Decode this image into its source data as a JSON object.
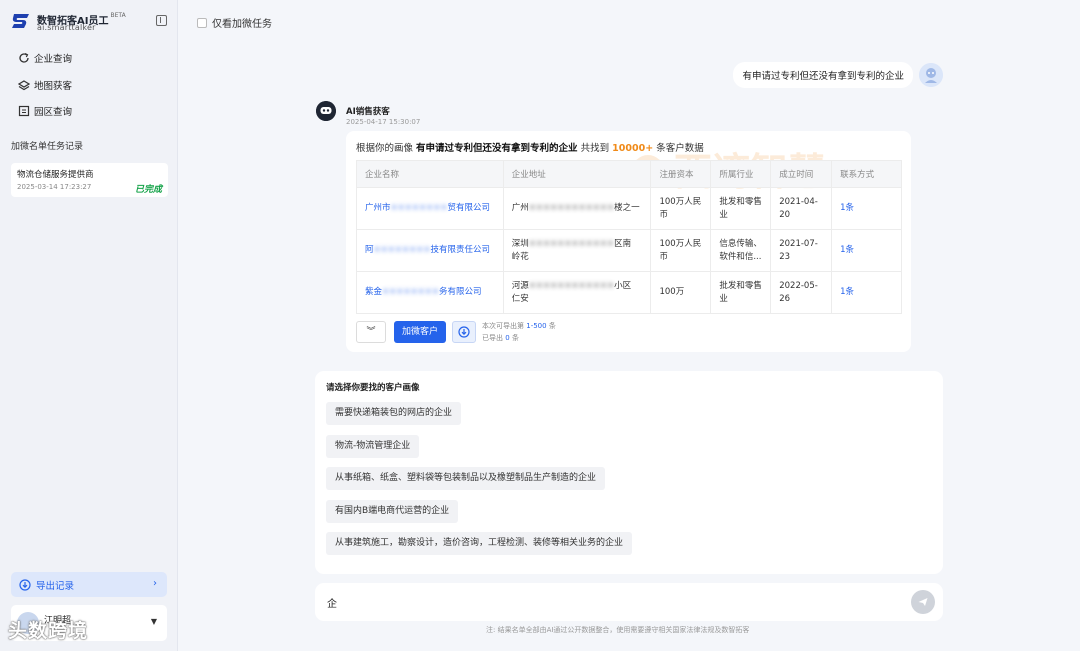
{
  "app": {
    "title": "数智拓客AI员工",
    "beta": "BETA",
    "domain": "ai.smarttalker"
  },
  "sidebar": {
    "nav": [
      {
        "label": "企业查询",
        "icon": "refresh-search-icon"
      },
      {
        "label": "地图获客",
        "icon": "map-layers-icon"
      },
      {
        "label": "园区查询",
        "icon": "park-building-icon"
      }
    ],
    "section_title": "加微名单任务记录",
    "task": {
      "name": "物流仓储服务提供商",
      "time": "2025-03-14 17:23:27",
      "status": "已完成"
    },
    "export_label": "导出记录",
    "user_name": "江明超"
  },
  "filter": {
    "label": "仅看加微任务"
  },
  "chat": {
    "user_message": "有申请过专利但还没有拿到专利的企业",
    "bot_name": "AI销售获客",
    "bot_time": "2025-04-17 15:30:07",
    "summary": {
      "prefix": "根据你的画像",
      "query": "有申请过专利但还没有拿到专利的企业",
      "mid": "共找到",
      "count": "10000+",
      "suffix": "条客户数据"
    },
    "watermark": "西湾智慧",
    "table": {
      "headers": [
        "企业名称",
        "企业地址",
        "注册资本",
        "所属行业",
        "成立时间",
        "联系方式"
      ],
      "rows": [
        {
          "name_a": "广州市",
          "name_mask": "××××××××",
          "name_b": "贸有限公司",
          "addr_a": "广州",
          "addr_mask": "××××××××××××",
          "addr_b": "楼之一",
          "addr_c": "",
          "capital": "100万人民币",
          "industry": "批发和零售业",
          "founded": "2021-04-20",
          "contact": "1条"
        },
        {
          "name_a": "阿",
          "name_mask": "××××××××",
          "name_b": "技有限责任公司",
          "addr_a": "深圳",
          "addr_mask": "××××××××××××",
          "addr_b": "区南",
          "addr_c": "岭花",
          "capital": "100万人民币",
          "industry": "信息传输、软件和信...",
          "founded": "2021-07-23",
          "contact": "1条"
        },
        {
          "name_a": "紫金",
          "name_mask": "××××××××",
          "name_b": "务有限公司",
          "addr_a": "河源",
          "addr_mask": "××××××××××××",
          "addr_b": "小区",
          "addr_c": "仁安",
          "capital": "100万",
          "industry": "批发和零售业",
          "founded": "2022-05-26",
          "contact": "1条"
        }
      ]
    },
    "actions": {
      "add_label": "加微客户",
      "export_range_prefix": "本次可导出第",
      "export_range": "1-500",
      "export_range_suffix": "条",
      "exported_prefix": "已导出",
      "exported": "0",
      "exported_suffix": "条"
    }
  },
  "picker": {
    "title": "请选择你要找的客户画像",
    "options": [
      "需要快递箱装包的网店的企业",
      "物流-物流管理企业",
      "从事纸箱、纸盒、塑料袋等包装制品以及橡塑制品生产制造的企业",
      "有国内B端电商代运营的企业",
      "从事建筑施工，勘察设计，造价咨询，工程检测、装修等相关业务的企业"
    ]
  },
  "input": {
    "value": "企"
  },
  "disclaimer": "注: 结果名单全部由AI通过公开数据整合，使用需要遵守相关国家法律法规及数智拓客",
  "brand_watermark": "头数跨境",
  "colors": {
    "accent": "#2563eb",
    "highlight": "#f08a18",
    "success": "#16a34a"
  }
}
